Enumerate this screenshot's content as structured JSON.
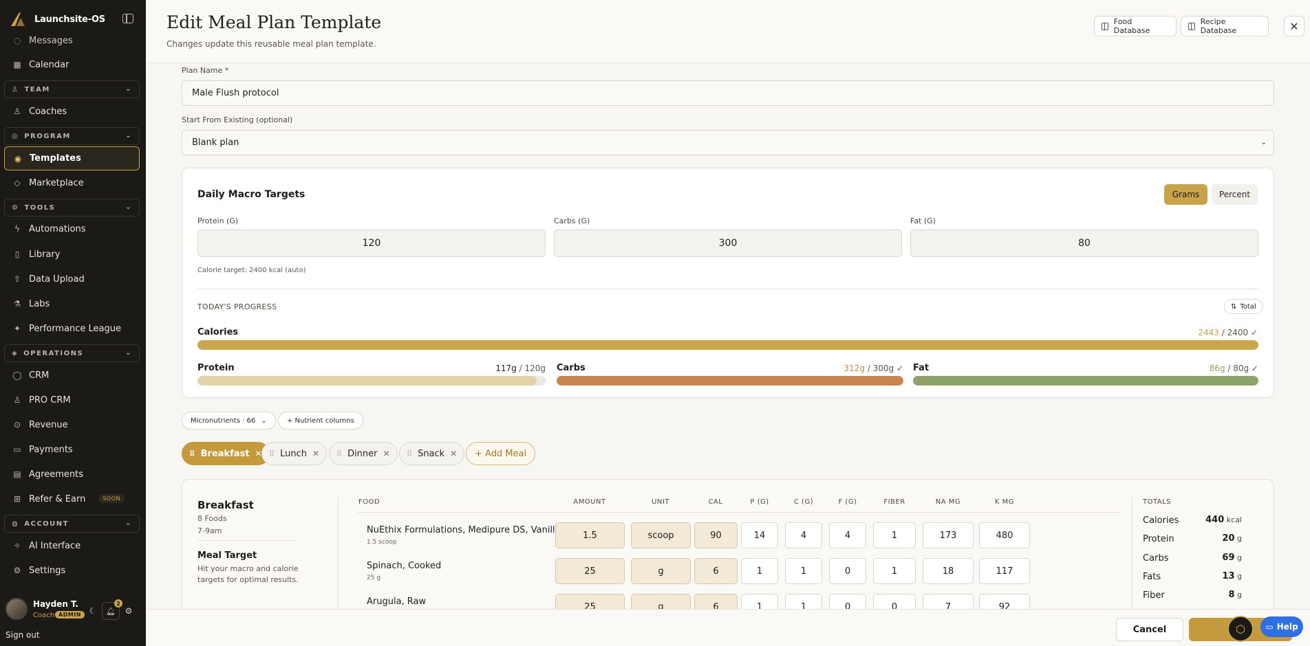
{
  "app": {
    "name": "Launchsite-OS"
  },
  "sidebar": {
    "partial_item": "Messages",
    "calendar": "Calendar",
    "team_section": "TEAM",
    "coaches": "Coaches",
    "program_section": "PROGRAM",
    "templates": "Templates",
    "marketplace": "Marketplace",
    "tools_section": "TOOLS",
    "automations": "Automations",
    "library": "Library",
    "data_upload": "Data Upload",
    "labs": "Labs",
    "performance_league": "Performance League",
    "operations_section": "OPERATIONS",
    "crm": "CRM",
    "pro_crm": "PRO CRM",
    "revenue": "Revenue",
    "payments": "Payments",
    "agreements": "Agreements",
    "refer_earn": "Refer & Earn",
    "soon_badge": "SOON",
    "account_section": "ACCOUNT",
    "ai_interface": "AI Interface",
    "settings": "Settings",
    "user_name": "Hayden T.",
    "user_role": "Coach",
    "admin_badge": "ADMIN",
    "notification_count": "2",
    "sign_out": "Sign out"
  },
  "header": {
    "title": "Edit Meal Plan Template",
    "subtitle": "Changes update this reusable meal plan template.",
    "food_db": "Food Database",
    "recipe_db": "Recipe Database"
  },
  "form": {
    "plan_name_label": "Plan Name *",
    "plan_name_value": "Male Flush protocol",
    "start_from_label": "Start From Existing (optional)",
    "start_from_value": "Blank plan"
  },
  "macros": {
    "title": "Daily Macro Targets",
    "grams": "Grams",
    "percent": "Percent",
    "protein_label": "Protein (G)",
    "protein_value": "120",
    "carbs_label": "Carbs (G)",
    "carbs_value": "300",
    "fat_label": "Fat (G)",
    "fat_value": "80",
    "calorie_target": "Calorie target: 2400 kcal (auto)"
  },
  "progress": {
    "title": "TODAY'S PROGRESS",
    "total_btn": "Total",
    "calories_label": "Calories",
    "calories_current": "2443",
    "calories_target": " / 2400 ✓",
    "calories_pct": 1.0,
    "protein_label": "Protein",
    "protein_current": "117g",
    "protein_target": " / 120g",
    "protein_pct": 0.975,
    "carbs_label": "Carbs",
    "carbs_current": "312g",
    "carbs_target": " / 300g ✓",
    "carbs_pct": 1.0,
    "fat_label": "Fat",
    "fat_current": "86g",
    "fat_target": " / 80g ✓",
    "fat_pct": 1.0,
    "colors": {
      "calories": "#c9a84c",
      "protein": "#e2d3a8",
      "carbs": "#c98550",
      "fat": "#8ea36a"
    }
  },
  "chips": {
    "micronutrients": "Micronutrients · 66",
    "nutrient_columns": "+ Nutrient columns"
  },
  "meals": {
    "tabs": [
      "Breakfast",
      "Lunch",
      "Dinner",
      "Snack"
    ],
    "add_meal": "+ Add Meal"
  },
  "breakfast": {
    "title": "Breakfast",
    "count": "8 Foods",
    "time": "7-9am",
    "target_title": "Meal Target",
    "target_desc": "Hit your macro and calorie targets for optimal results.",
    "columns": [
      "FOOD",
      "AMOUNT",
      "UNIT",
      "CAL",
      "P (G)",
      "C (G)",
      "F (G)",
      "FIBER",
      "NA MG",
      "K MG"
    ],
    "rows": [
      {
        "name": "NuEthix Formulations, Medipure DS, Vanilla Wafer",
        "sub": "1.5 scoop",
        "amount": "1.5",
        "unit": "scoop",
        "cal": "90",
        "p": "14",
        "c": "4",
        "f": "4",
        "fiber": "1",
        "na": "173",
        "k": "480"
      },
      {
        "name": "Spinach, Cooked",
        "sub": "25 g",
        "amount": "25",
        "unit": "g",
        "cal": "6",
        "p": "1",
        "c": "1",
        "f": "0",
        "fiber": "1",
        "na": "18",
        "k": "117"
      },
      {
        "name": "Arugula, Raw",
        "sub": "",
        "amount": "25",
        "unit": "g",
        "cal": "6",
        "p": "1",
        "c": "1",
        "f": "0",
        "fiber": "0",
        "na": "7",
        "k": "92"
      }
    ],
    "totals_title": "TOTALS",
    "totals": [
      {
        "label": "Calories",
        "value": "440",
        "unit": " kcal"
      },
      {
        "label": "Protein",
        "value": "20",
        "unit": " g"
      },
      {
        "label": "Carbs",
        "value": "69",
        "unit": " g"
      },
      {
        "label": "Fats",
        "value": "13",
        "unit": " g"
      },
      {
        "label": "Fiber",
        "value": "8",
        "unit": " g"
      }
    ]
  },
  "footer": {
    "cancel": "Cancel",
    "help": "Help"
  }
}
